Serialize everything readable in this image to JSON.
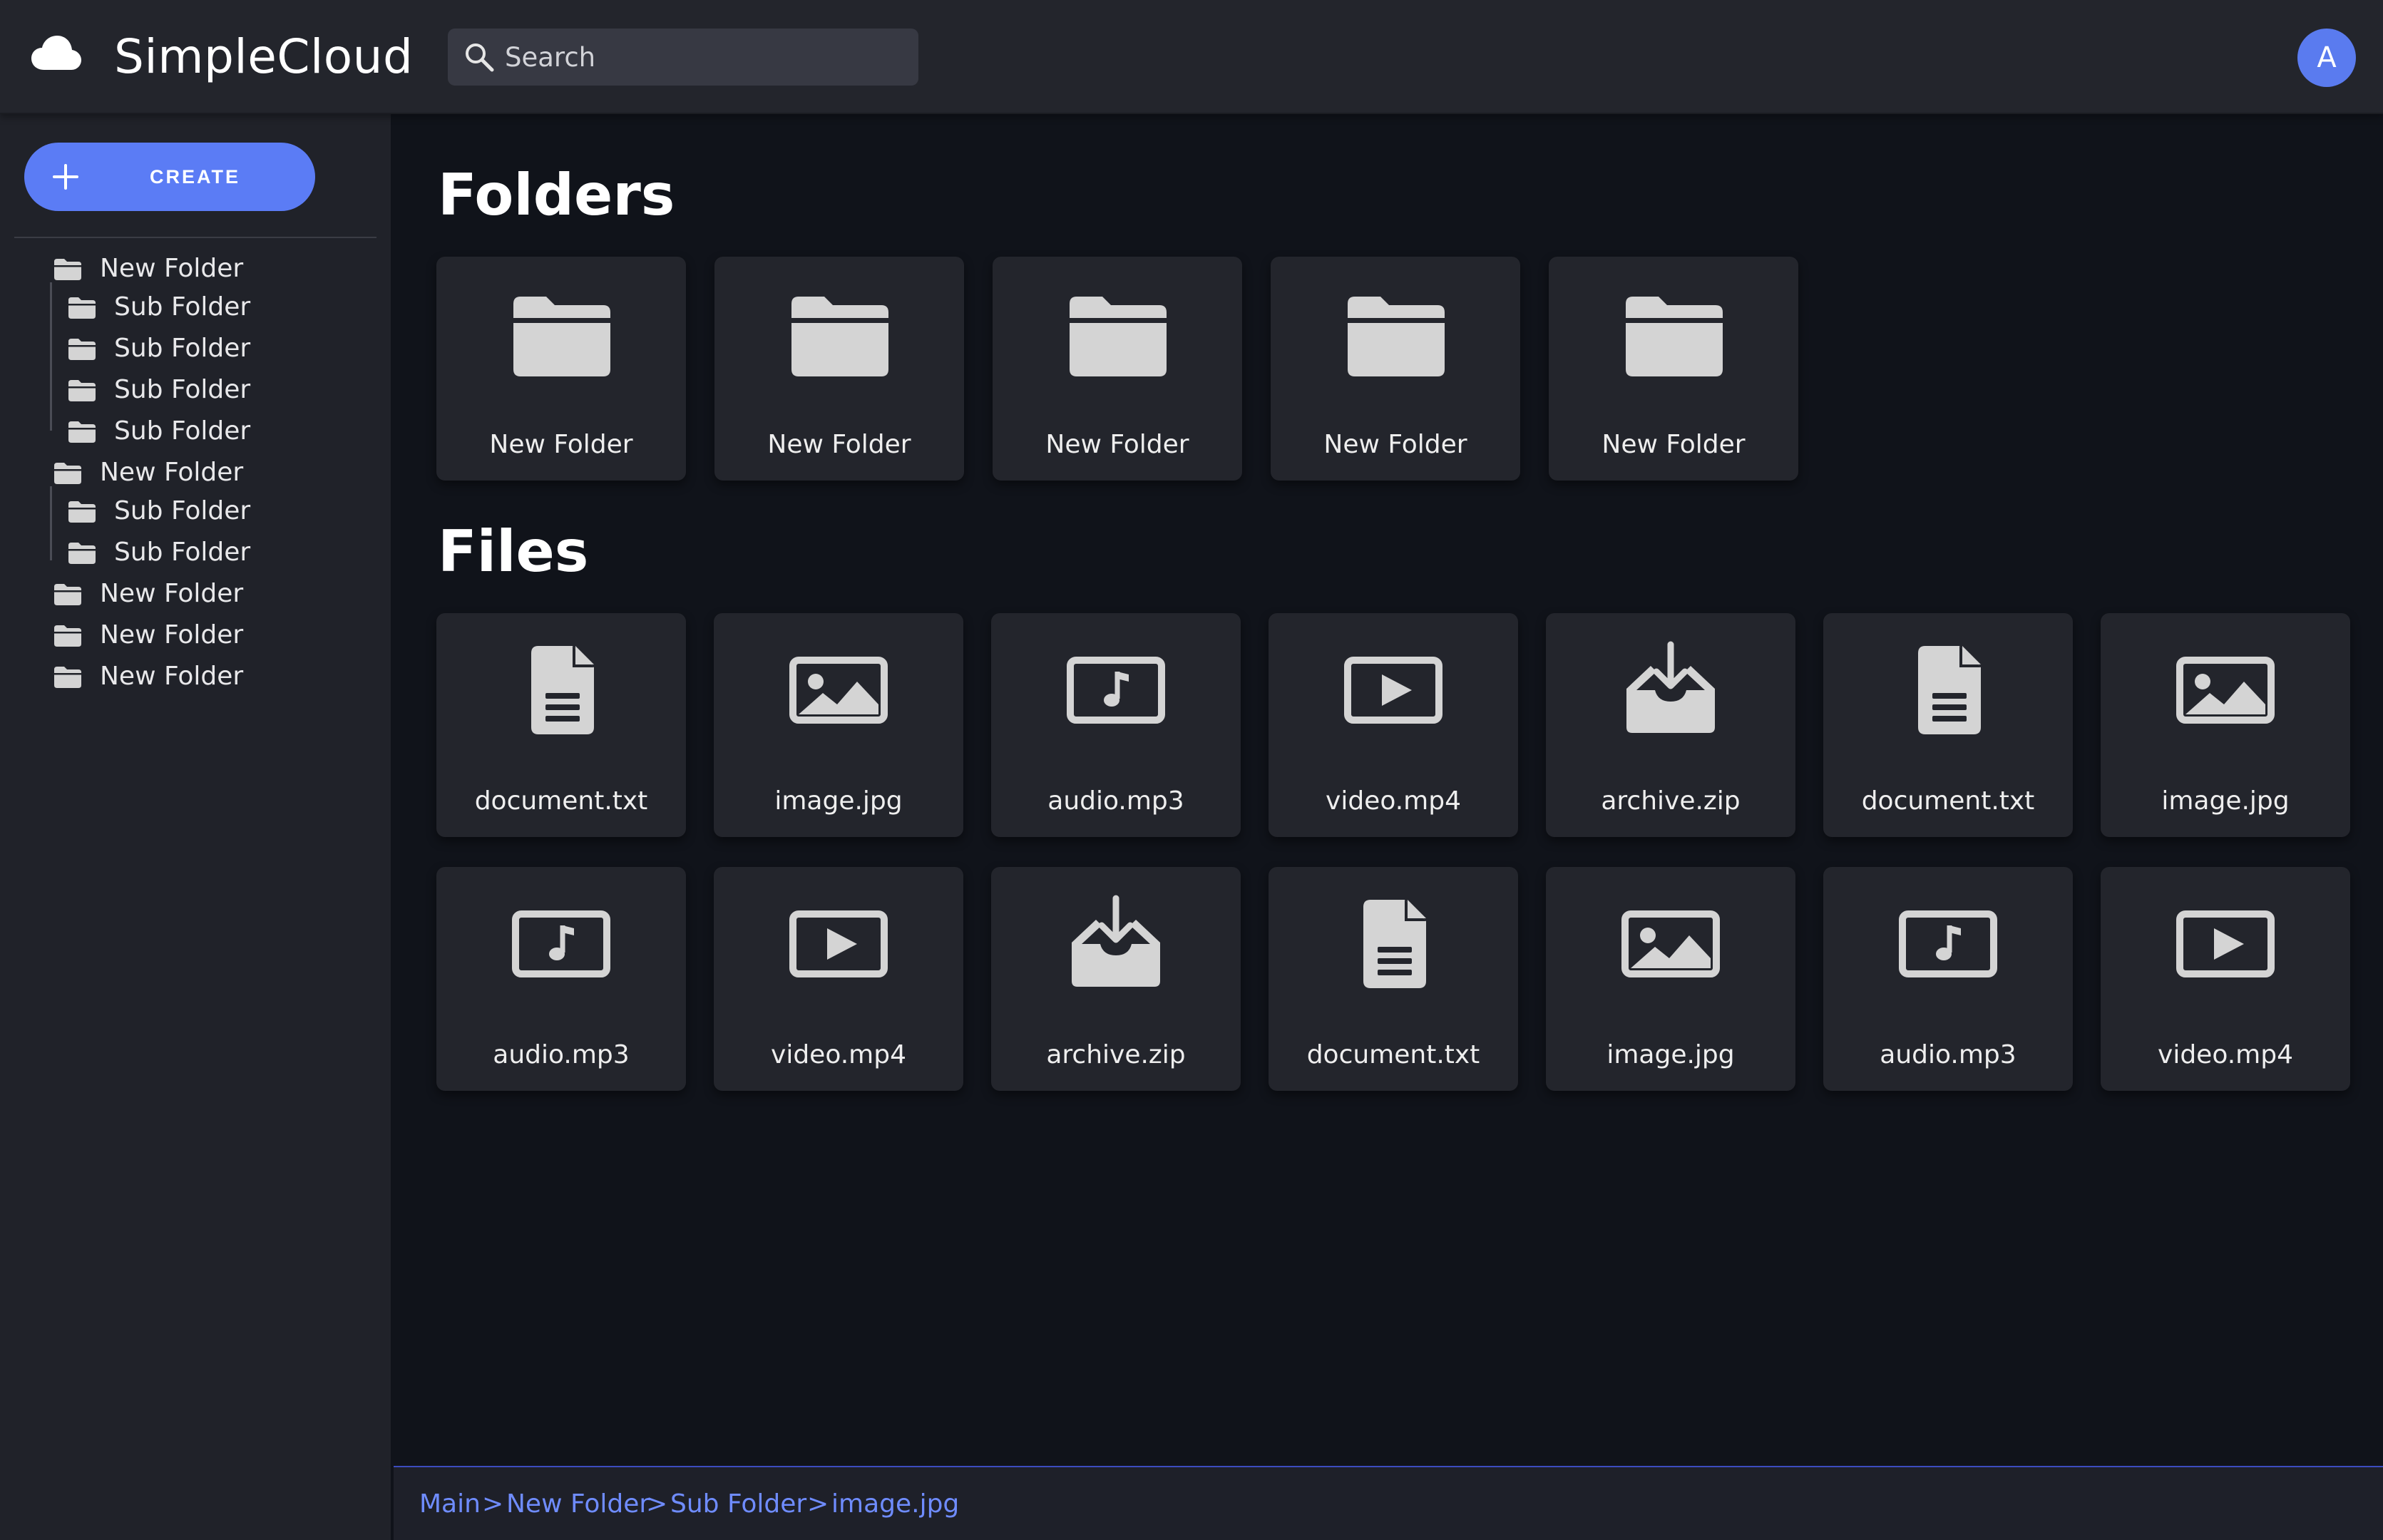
{
  "app": {
    "title": "SimpleCloud",
    "logo_icon": "cloud-icon"
  },
  "search": {
    "placeholder": "Search",
    "value": "",
    "icon": "search-icon"
  },
  "user": {
    "avatar_initial": "A",
    "avatar_color": "#5a7bef"
  },
  "sidebar": {
    "create_label": "CREATE",
    "create_icon": "plus-icon",
    "tree": [
      {
        "label": "New Folder",
        "level": 0
      },
      {
        "label": "Sub Folder",
        "level": 1
      },
      {
        "label": "Sub Folder",
        "level": 1
      },
      {
        "label": "Sub Folder",
        "level": 1
      },
      {
        "label": "Sub Folder",
        "level": 1
      },
      {
        "label": "New Folder",
        "level": 0
      },
      {
        "label": "Sub Folder",
        "level": 1
      },
      {
        "label": "Sub Folder",
        "level": 1
      },
      {
        "label": "New Folder",
        "level": 0
      },
      {
        "label": "New Folder",
        "level": 0
      },
      {
        "label": "New Folder",
        "level": 0
      }
    ]
  },
  "main": {
    "folders_heading": "Folders",
    "files_heading": "Files",
    "folders": [
      {
        "name": "New Folder",
        "icon": "folder-icon"
      },
      {
        "name": "New Folder",
        "icon": "folder-icon"
      },
      {
        "name": "New Folder",
        "icon": "folder-icon"
      },
      {
        "name": "New Folder",
        "icon": "folder-icon"
      },
      {
        "name": "New Folder",
        "icon": "folder-icon"
      }
    ],
    "files": [
      {
        "name": "document.txt",
        "icon": "document-icon"
      },
      {
        "name": "image.jpg",
        "icon": "image-icon"
      },
      {
        "name": "audio.mp3",
        "icon": "audio-icon"
      },
      {
        "name": "video.mp4",
        "icon": "video-icon"
      },
      {
        "name": "archive.zip",
        "icon": "archive-icon"
      },
      {
        "name": "document.txt",
        "icon": "document-icon"
      },
      {
        "name": "image.jpg",
        "icon": "image-icon"
      },
      {
        "name": "audio.mp3",
        "icon": "audio-icon"
      },
      {
        "name": "video.mp4",
        "icon": "video-icon"
      },
      {
        "name": "archive.zip",
        "icon": "archive-icon"
      },
      {
        "name": "document.txt",
        "icon": "document-icon"
      },
      {
        "name": "image.jpg",
        "icon": "image-icon"
      },
      {
        "name": "audio.mp3",
        "icon": "audio-icon"
      },
      {
        "name": "video.mp4",
        "icon": "video-icon"
      }
    ]
  },
  "breadcrumb": {
    "separator": ">",
    "items": [
      "Main",
      "New Folder",
      "Sub Folder",
      "image.jpg"
    ]
  },
  "colors": {
    "accent": "#5b7cf5",
    "link": "#6f8cff",
    "background": "#10131a",
    "surface": "#23252c",
    "icon": "#d4d4d4"
  }
}
